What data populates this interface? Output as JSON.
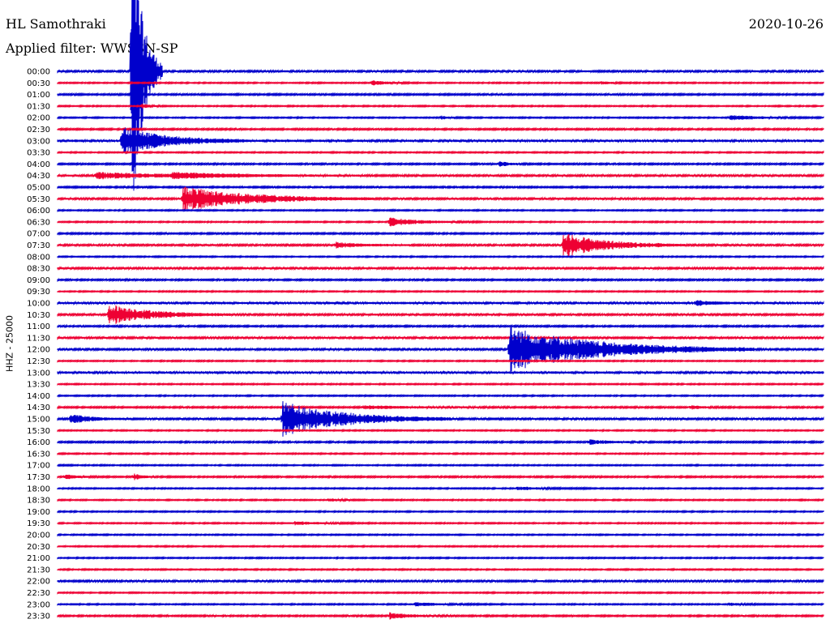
{
  "header": {
    "station": "HL Samothraki",
    "date": "2020-10-26",
    "filter": "Applied filter: WWSSN-SP"
  },
  "chart_data": {
    "type": "helicorder",
    "title": "HL Samothraki",
    "date": "2020-10-26",
    "filter": "Applied filter: WWSSN-SP",
    "ylabel": "HHZ - 25000",
    "trace_colors": [
      "#0000cc",
      "#ee0033"
    ],
    "x_range_minutes": [
      0,
      30
    ],
    "rows": [
      {
        "label": "00:00",
        "color": "#0000cc",
        "noise": 1.2,
        "events": [
          {
            "t": 2.9,
            "amp": 200,
            "dur": 0.4
          }
        ]
      },
      {
        "label": "00:30",
        "color": "#ee0033",
        "noise": 0.8,
        "events": [
          {
            "t": 12.3,
            "amp": 3,
            "dur": 0.6
          },
          {
            "t": 21.3,
            "amp": 2,
            "dur": 0.4
          }
        ]
      },
      {
        "label": "01:00",
        "color": "#0000cc",
        "noise": 1.0,
        "events": []
      },
      {
        "label": "01:30",
        "color": "#ee0033",
        "noise": 0.8,
        "events": [
          {
            "t": 3.3,
            "amp": 3,
            "dur": 0.3
          }
        ]
      },
      {
        "label": "02:00",
        "color": "#0000cc",
        "noise": 0.8,
        "events": [
          {
            "t": 15.0,
            "amp": 2,
            "dur": 0.4
          },
          {
            "t": 26.3,
            "amp": 3,
            "dur": 1.2
          }
        ]
      },
      {
        "label": "02:30",
        "color": "#ee0033",
        "noise": 1.0,
        "events": []
      },
      {
        "label": "03:00",
        "color": "#0000cc",
        "noise": 1.5,
        "events": [
          {
            "t": 2.5,
            "amp": 18,
            "dur": 1.6
          }
        ]
      },
      {
        "label": "03:30",
        "color": "#ee0033",
        "noise": 0.8,
        "events": []
      },
      {
        "label": "04:00",
        "color": "#0000cc",
        "noise": 1.0,
        "events": [
          {
            "t": 17.3,
            "amp": 3,
            "dur": 0.4
          }
        ]
      },
      {
        "label": "04:30",
        "color": "#ee0033",
        "noise": 1.2,
        "events": [
          {
            "t": 1.5,
            "amp": 4,
            "dur": 2.5
          },
          {
            "t": 4.5,
            "amp": 3,
            "dur": 2.5
          }
        ]
      },
      {
        "label": "05:00",
        "color": "#0000cc",
        "noise": 1.0,
        "events": []
      },
      {
        "label": "05:30",
        "color": "#ee0033",
        "noise": 1.2,
        "events": [
          {
            "t": 4.9,
            "amp": 15,
            "dur": 2.5
          }
        ]
      },
      {
        "label": "06:00",
        "color": "#0000cc",
        "noise": 0.8,
        "events": []
      },
      {
        "label": "06:30",
        "color": "#ee0033",
        "noise": 0.8,
        "events": [
          {
            "t": 13.0,
            "amp": 5,
            "dur": 1.2
          }
        ]
      },
      {
        "label": "07:00",
        "color": "#0000cc",
        "noise": 1.0,
        "events": []
      },
      {
        "label": "07:30",
        "color": "#ee0033",
        "noise": 1.2,
        "events": [
          {
            "t": 10.9,
            "amp": 3,
            "dur": 1.0
          },
          {
            "t": 19.8,
            "amp": 15,
            "dur": 1.6
          }
        ]
      },
      {
        "label": "08:00",
        "color": "#0000cc",
        "noise": 0.8,
        "events": []
      },
      {
        "label": "08:30",
        "color": "#ee0033",
        "noise": 1.2,
        "events": []
      },
      {
        "label": "09:00",
        "color": "#0000cc",
        "noise": 1.0,
        "events": []
      },
      {
        "label": "09:30",
        "color": "#ee0033",
        "noise": 0.8,
        "events": []
      },
      {
        "label": "10:00",
        "color": "#0000cc",
        "noise": 1.5,
        "events": [
          {
            "t": 25.0,
            "amp": 3,
            "dur": 0.6
          }
        ]
      },
      {
        "label": "10:30",
        "color": "#ee0033",
        "noise": 1.2,
        "events": [
          {
            "t": 2.0,
            "amp": 13,
            "dur": 1.6
          }
        ]
      },
      {
        "label": "11:00",
        "color": "#0000cc",
        "noise": 1.0,
        "events": []
      },
      {
        "label": "11:30",
        "color": "#ee0033",
        "noise": 1.2,
        "events": []
      },
      {
        "label": "12:00",
        "color": "#0000cc",
        "noise": 1.2,
        "events": [
          {
            "t": 17.7,
            "amp": 28,
            "dur": 3.2
          }
        ]
      },
      {
        "label": "12:30",
        "color": "#ee0033",
        "noise": 0.8,
        "events": []
      },
      {
        "label": "13:00",
        "color": "#0000cc",
        "noise": 1.5,
        "events": []
      },
      {
        "label": "13:30",
        "color": "#ee0033",
        "noise": 0.8,
        "events": []
      },
      {
        "label": "14:00",
        "color": "#0000cc",
        "noise": 0.8,
        "events": []
      },
      {
        "label": "14:30",
        "color": "#ee0033",
        "noise": 1.0,
        "events": [
          {
            "t": 12.0,
            "amp": 2,
            "dur": 2.0
          },
          {
            "t": 24.8,
            "amp": 3,
            "dur": 0.4
          }
        ]
      },
      {
        "label": "15:00",
        "color": "#0000cc",
        "noise": 1.2,
        "events": [
          {
            "t": 0.5,
            "amp": 6,
            "dur": 0.8
          },
          {
            "t": 8.8,
            "amp": 22,
            "dur": 2.2
          }
        ]
      },
      {
        "label": "15:30",
        "color": "#ee0033",
        "noise": 0.8,
        "events": []
      },
      {
        "label": "16:00",
        "color": "#0000cc",
        "noise": 1.0,
        "events": [
          {
            "t": 20.8,
            "amp": 3,
            "dur": 0.8
          }
        ]
      },
      {
        "label": "16:30",
        "color": "#ee0033",
        "noise": 0.8,
        "events": []
      },
      {
        "label": "17:00",
        "color": "#0000cc",
        "noise": 0.8,
        "events": []
      },
      {
        "label": "17:30",
        "color": "#ee0033",
        "noise": 1.0,
        "events": [
          {
            "t": 0.3,
            "amp": 3,
            "dur": 0.4
          },
          {
            "t": 3.0,
            "amp": 4,
            "dur": 0.3
          }
        ]
      },
      {
        "label": "18:00",
        "color": "#0000cc",
        "noise": 0.8,
        "events": [
          {
            "t": 18.0,
            "amp": 2,
            "dur": 1.0
          }
        ]
      },
      {
        "label": "18:30",
        "color": "#ee0033",
        "noise": 0.8,
        "events": [
          {
            "t": 10.6,
            "amp": 2,
            "dur": 0.5
          }
        ]
      },
      {
        "label": "19:00",
        "color": "#0000cc",
        "noise": 0.8,
        "events": []
      },
      {
        "label": "19:30",
        "color": "#ee0033",
        "noise": 0.8,
        "events": [
          {
            "t": 9.3,
            "amp": 2,
            "dur": 1.0
          }
        ]
      },
      {
        "label": "20:00",
        "color": "#0000cc",
        "noise": 0.8,
        "events": []
      },
      {
        "label": "20:30",
        "color": "#ee0033",
        "noise": 0.8,
        "events": []
      },
      {
        "label": "21:00",
        "color": "#0000cc",
        "noise": 0.8,
        "events": []
      },
      {
        "label": "21:30",
        "color": "#ee0033",
        "noise": 0.8,
        "events": []
      },
      {
        "label": "22:00",
        "color": "#0000cc",
        "noise": 1.2,
        "events": []
      },
      {
        "label": "22:30",
        "color": "#ee0033",
        "noise": 0.8,
        "events": []
      },
      {
        "label": "23:00",
        "color": "#0000cc",
        "noise": 0.8,
        "events": [
          {
            "t": 14.0,
            "amp": 2,
            "dur": 1.2
          },
          {
            "t": 26.3,
            "amp": 2,
            "dur": 0.5
          }
        ]
      },
      {
        "label": "23:30",
        "color": "#ee0033",
        "noise": 1.0,
        "events": [
          {
            "t": 13.0,
            "amp": 4,
            "dur": 0.8
          }
        ]
      }
    ]
  }
}
